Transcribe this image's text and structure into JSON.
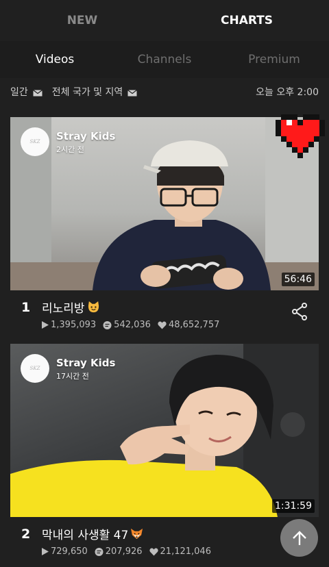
{
  "top_tabs": [
    {
      "label": "NEW",
      "active": false
    },
    {
      "label": "CHARTS",
      "active": true
    }
  ],
  "sub_tabs": [
    {
      "label": "Videos",
      "active": true
    },
    {
      "label": "Channels",
      "active": false
    },
    {
      "label": "Premium",
      "active": false
    }
  ],
  "filters": {
    "period": "일간",
    "region": "전체 국가 및 지역",
    "updated": "오늘 오후 2:00"
  },
  "videos": [
    {
      "rank": "1",
      "channel": "Stray Kids",
      "avatar_text": "SKZ",
      "ago": "2시간 전",
      "duration": "56:46",
      "title": "리노리방",
      "title_emoji": "cat-face-emoji",
      "plays": "1,395,093",
      "comments": "542,036",
      "hearts": "48,652,757"
    },
    {
      "rank": "2",
      "channel": "Stray Kids",
      "avatar_text": "SKZ",
      "ago": "17시간 전",
      "duration": "1:31:59",
      "title": "막내의 사생활 47",
      "title_emoji": "fox-face-emoji",
      "plays": "729,650",
      "comments": "207,926",
      "hearts": "21,121,046"
    }
  ],
  "colors": {
    "background": "#202020",
    "heart_red": "#ff1a1a",
    "subdued_text": "#bdbdbd"
  }
}
